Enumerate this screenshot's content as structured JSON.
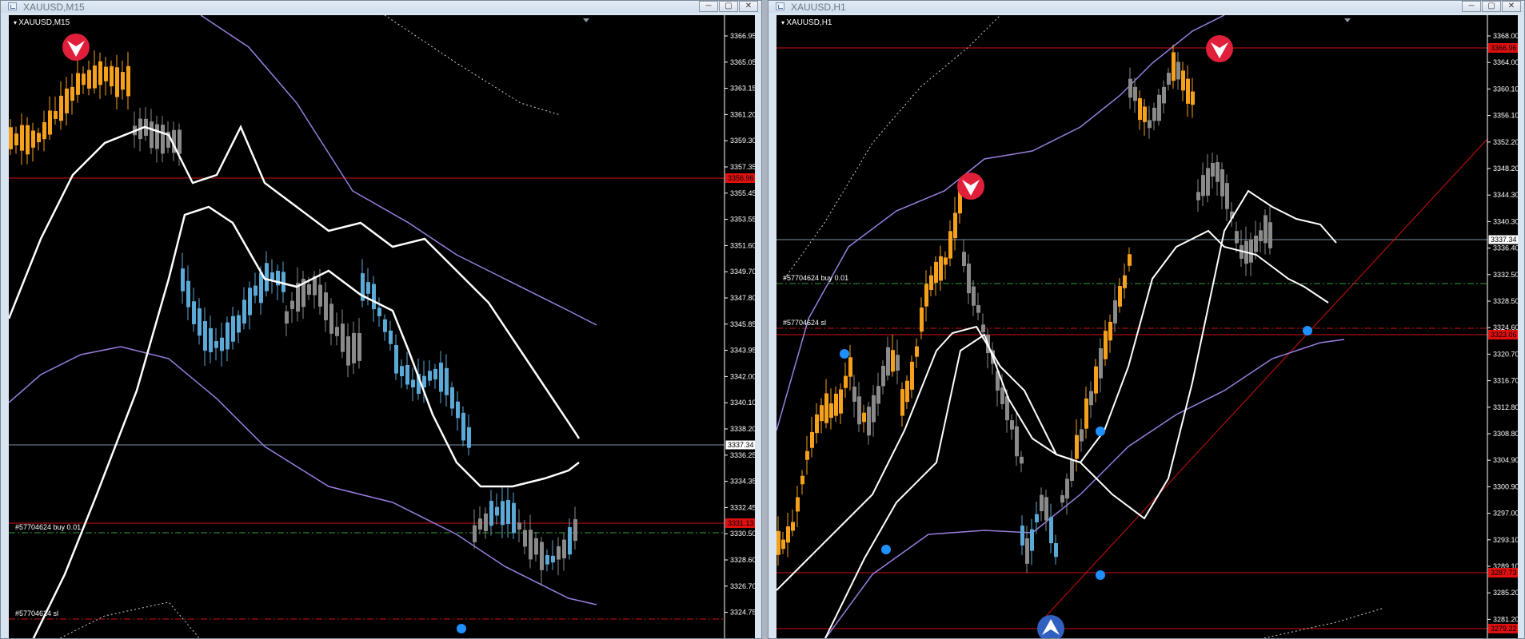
{
  "windows": [
    {
      "title": "XAUUSD,M15",
      "symbol_label": "XAUUSD,M15",
      "price_axis": [
        "3366.95",
        "3365.05",
        "3363.15",
        "3361.20",
        "3359.30",
        "3357.35",
        "3355.45",
        "3353.55",
        "3351.60",
        "3349.70",
        "3347.80",
        "3345.85",
        "3343.95",
        "3342.00",
        "3340.10",
        "3338.20",
        "3336.25",
        "3334.35",
        "3332.45",
        "3330.50",
        "3328.60",
        "3326.70",
        "3324.75"
      ],
      "price_tags": [
        {
          "label": "3356.96",
          "color": "#e01010"
        },
        {
          "label": "3337.34",
          "color": "#000000"
        },
        {
          "label": "3331.13",
          "color": "#e01010"
        }
      ],
      "order_labels": [
        "#57704624 buy 0.01",
        "#57704624 sl"
      ]
    },
    {
      "title": "XAUUSD,H1",
      "symbol_label": "XAUUSD,H1",
      "price_axis": [
        "3368.00",
        "3364.00",
        "3360.10",
        "3356.10",
        "3352.20",
        "3348.20",
        "3344.30",
        "3340.30",
        "3336.40",
        "3332.50",
        "3328.50",
        "3324.60",
        "3320.70",
        "3316.70",
        "3312.80",
        "3308.80",
        "3304.90",
        "3300.90",
        "3297.00",
        "3293.10",
        "3289.10",
        "3285.20",
        "3281.20"
      ],
      "price_tags": [
        {
          "label": "3366.96",
          "color": "#e01010"
        },
        {
          "label": "3337.34",
          "color": "#000000"
        },
        {
          "label": "3323.06",
          "color": "#e01010"
        },
        {
          "label": "3287.73",
          "color": "#e01010"
        },
        {
          "label": "3279.22",
          "color": "#e01010"
        }
      ],
      "order_labels": [
        "#57704624 buy 0.01",
        "#57704624 sl"
      ]
    }
  ],
  "colors": {
    "bull": "#f5a11c",
    "bear": "#5ba9d6",
    "neutral": "#8a8a8a",
    "ma": "#ffffff",
    "band": "#9a7fe0",
    "level": "#d11010",
    "entry": "#2e9c3c",
    "dot": "#1e90ff"
  }
}
